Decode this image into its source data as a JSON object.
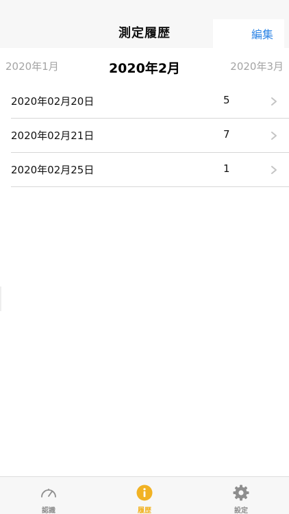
{
  "nav": {
    "title": "測定履歴",
    "edit_label": "編集"
  },
  "months": {
    "prev": "2020年1月",
    "current": "2020年2月",
    "next": "2020年3月"
  },
  "records": [
    {
      "date": "2020年02月20日",
      "count": "5"
    },
    {
      "date": "2020年02月21日",
      "count": "7"
    },
    {
      "date": "2020年02月25日",
      "count": "1"
    }
  ],
  "tabs": [
    {
      "label": "認識",
      "icon": "speedometer-icon",
      "active": false
    },
    {
      "label": "履歴",
      "icon": "info-icon",
      "active": true
    },
    {
      "label": "設定",
      "icon": "gear-icon",
      "active": false
    }
  ],
  "colors": {
    "accent": "#2f86e6",
    "active_tab": "#f1b224",
    "inactive_tab": "#8e8e8e"
  }
}
